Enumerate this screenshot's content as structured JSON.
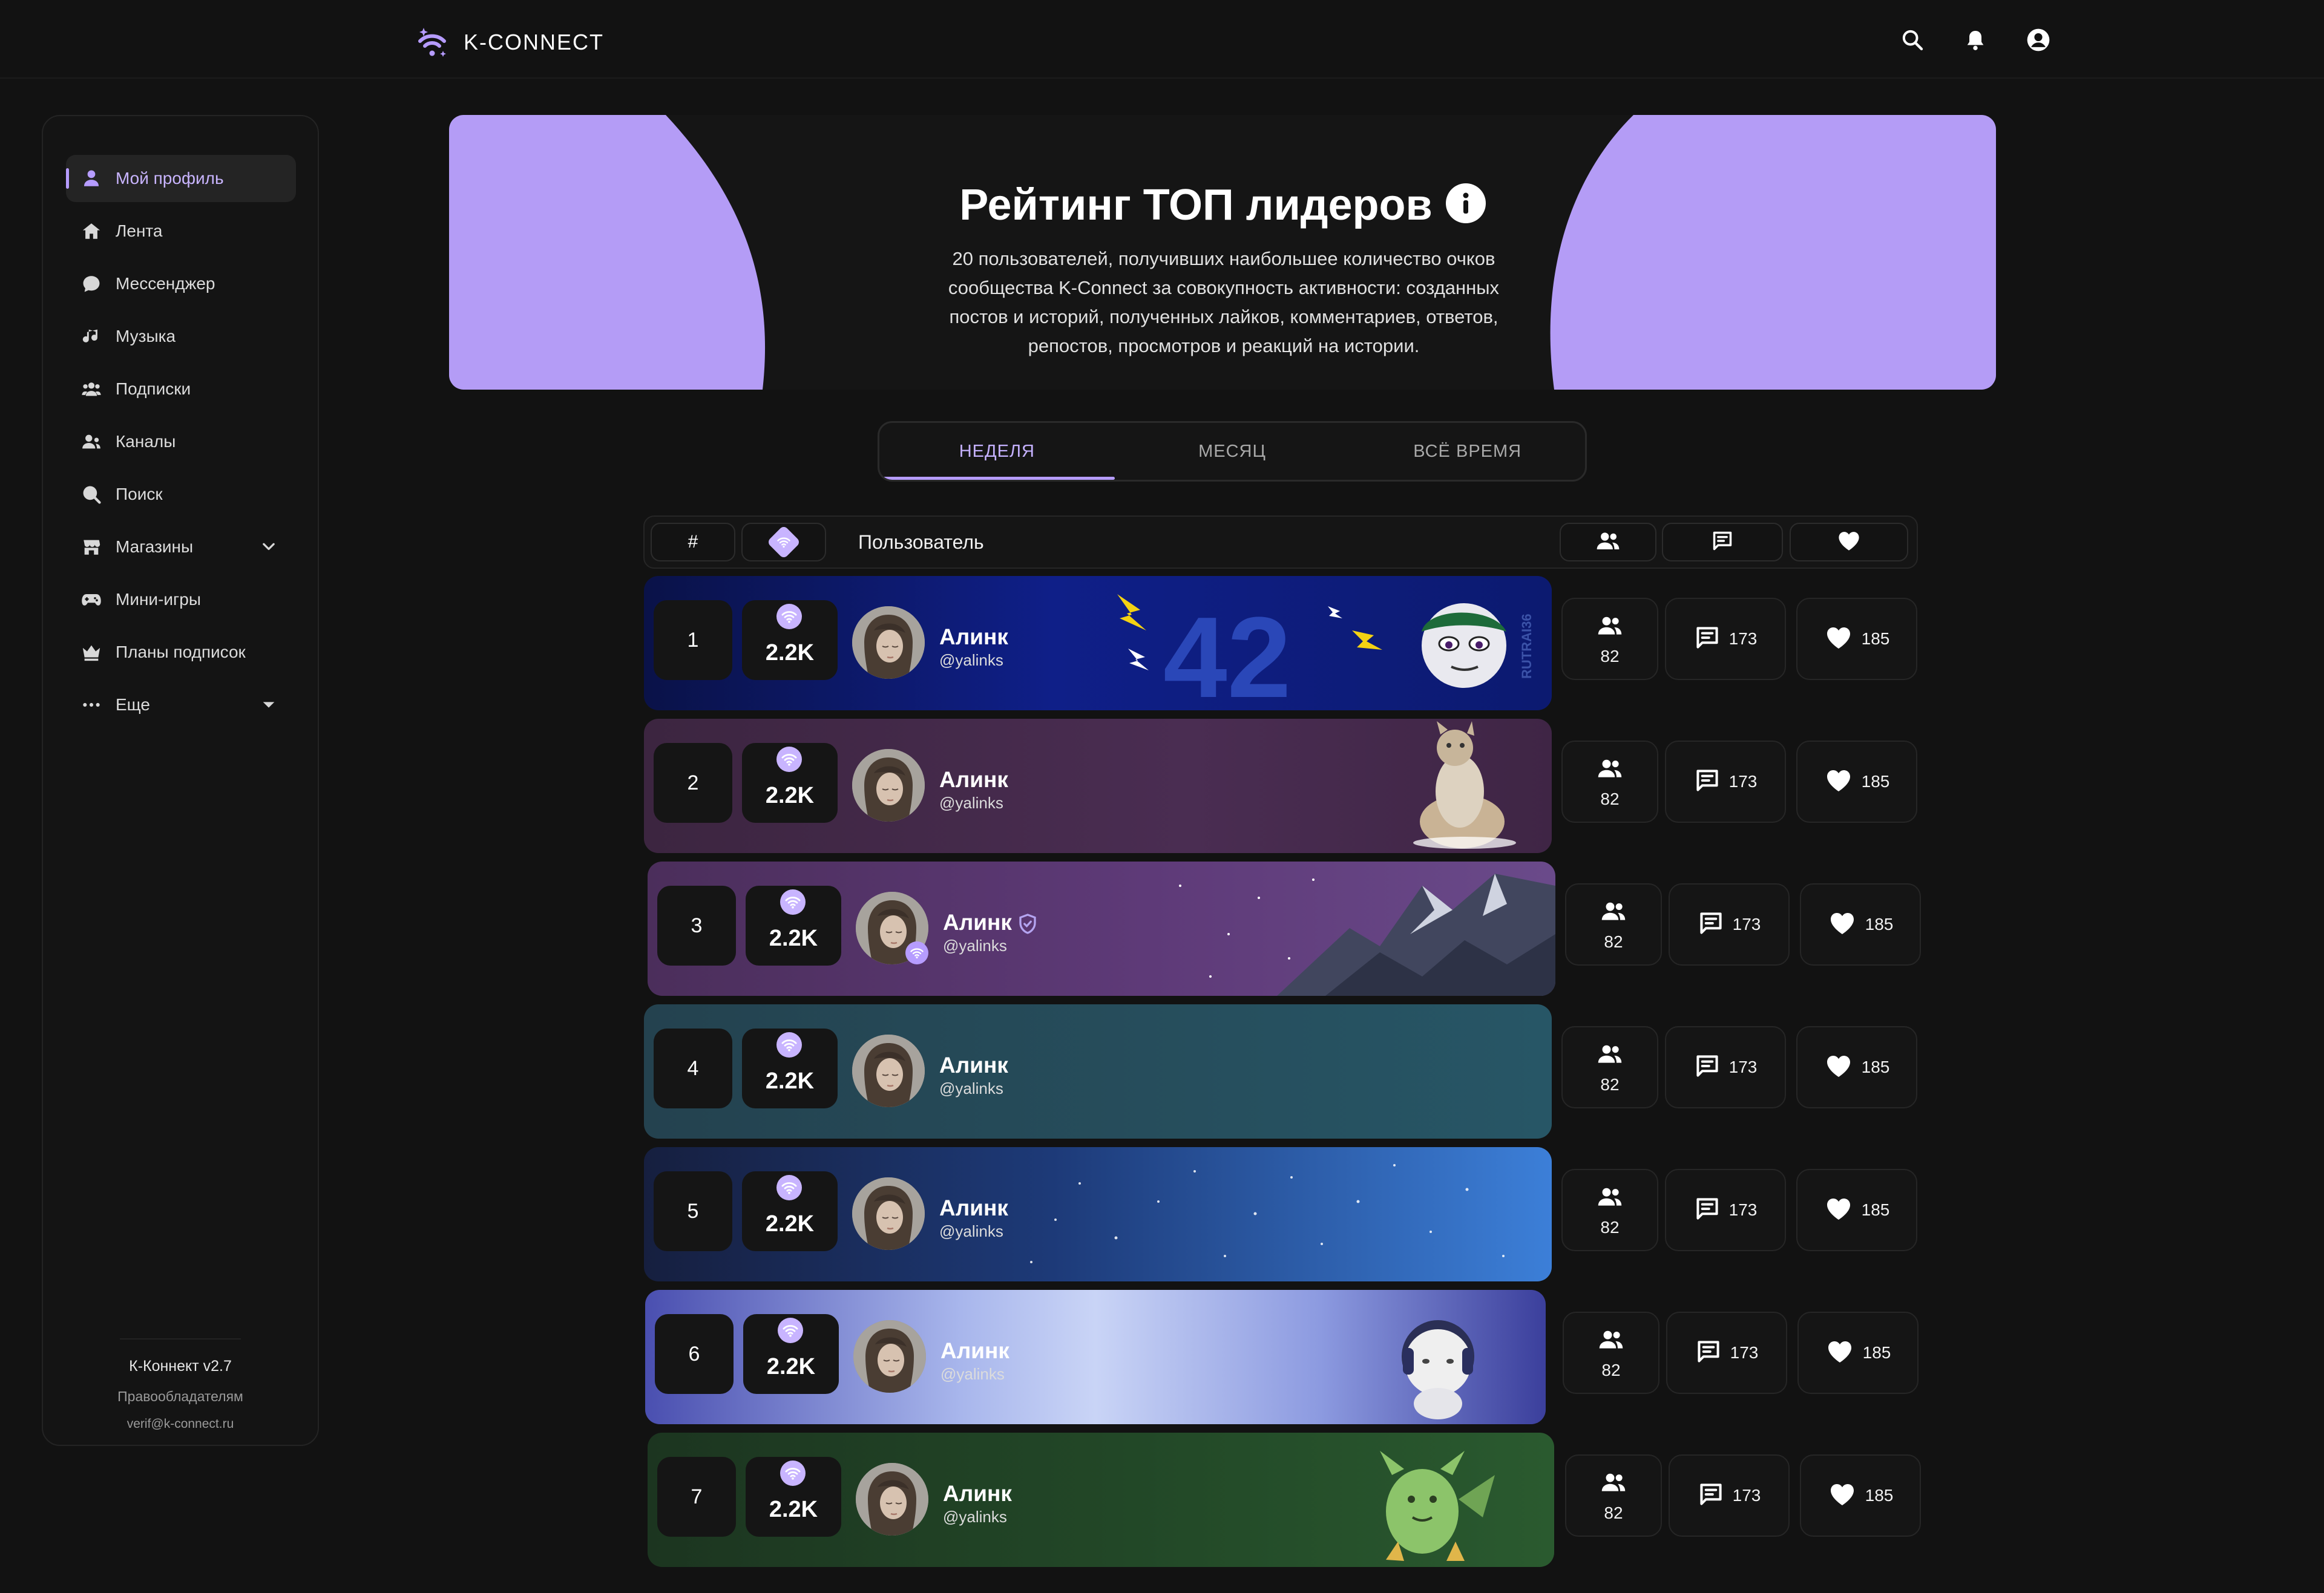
{
  "app": {
    "name": "K-CONNECT"
  },
  "topbar": {
    "icons": [
      "search-icon",
      "bell-icon",
      "account-icon"
    ]
  },
  "sidebar": {
    "items": [
      {
        "label": "Мой профиль",
        "icon": "person-icon",
        "active": true
      },
      {
        "label": "Лента",
        "icon": "home-icon"
      },
      {
        "label": "Мессенджер",
        "icon": "chat-icon"
      },
      {
        "label": "Музыка",
        "icon": "music-icon"
      },
      {
        "label": "Подписки",
        "icon": "group-icon"
      },
      {
        "label": "Каналы",
        "icon": "channels-icon"
      },
      {
        "label": "Поиск",
        "icon": "search-icon"
      },
      {
        "label": "Магазины",
        "icon": "store-icon",
        "chevron": "chevron-down-icon"
      },
      {
        "label": "Мини-игры",
        "icon": "gamepad-icon"
      },
      {
        "label": "Планы подписок",
        "icon": "crown-icon"
      },
      {
        "label": "Еще",
        "icon": "more-icon",
        "chevron": "caret-down-icon"
      }
    ],
    "footer": {
      "version": "К-Коннект v2.7",
      "rights": "Правообладателям",
      "email": "verif@k-connect.ru"
    }
  },
  "banner": {
    "title": "Рейтинг ТОП лидеров",
    "description": "20 пользователей, получивших наибольшее количество очков сообщества K-Connect за совокупность активности: созданных постов и историй, полученных лайков, комментариев, ответов, репостов, просмотров и реакций на истории.",
    "accent": "#b49cf6"
  },
  "tabs": [
    {
      "label": "НЕДЕЛЯ",
      "active": true
    },
    {
      "label": "МЕСЯЦ",
      "active": false
    },
    {
      "label": "ВСЁ ВРЕМЯ",
      "active": false
    }
  ],
  "table_header": {
    "rank": "#",
    "user": "Пользователь"
  },
  "rows": [
    {
      "rank": "1",
      "score": "2.2K",
      "name": "Алинк",
      "handle": "@yalinks",
      "followers": "82",
      "comments": "173",
      "likes": "185",
      "decoration_text": "42",
      "side_text": "RUTRAI36"
    },
    {
      "rank": "2",
      "score": "2.2K",
      "name": "Алинк",
      "handle": "@yalinks",
      "followers": "82",
      "comments": "173",
      "likes": "185"
    },
    {
      "rank": "3",
      "score": "2.2K",
      "name": "Алинк",
      "handle": "@yalinks",
      "followers": "82",
      "comments": "173",
      "likes": "185",
      "verified": true
    },
    {
      "rank": "4",
      "score": "2.2K",
      "name": "Алинк",
      "handle": "@yalinks",
      "followers": "82",
      "comments": "173",
      "likes": "185"
    },
    {
      "rank": "5",
      "score": "2.2K",
      "name": "Алинк",
      "handle": "@yalinks",
      "followers": "82",
      "comments": "173",
      "likes": "185"
    },
    {
      "rank": "6",
      "score": "2.2K",
      "name": "Алинк",
      "handle": "@yalinks",
      "followers": "82",
      "comments": "173",
      "likes": "185"
    },
    {
      "rank": "7",
      "score": "2.2K",
      "name": "Алинк",
      "handle": "@yalinks",
      "followers": "82",
      "comments": "173",
      "likes": "185"
    }
  ]
}
